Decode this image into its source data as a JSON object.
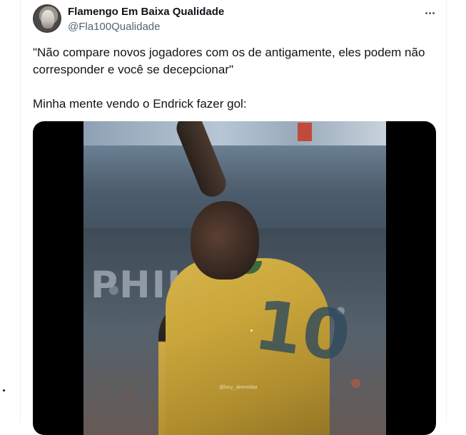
{
  "tweet": {
    "author": {
      "display_name": "Flamengo Em Baixa Qualidade",
      "handle": "@Fla100Qualidade"
    },
    "text": {
      "paragraph_1": "\"Não compare novos jogadores com os de antigamente, eles podem não corresponder e você se decepcionar\"",
      "paragraph_2": "Minha mente vendo o Endrick fazer gol:"
    },
    "media": {
      "jersey_number": "10",
      "stadium_sign": "PHILI",
      "watermark": "@lucy_ainevidaa"
    }
  },
  "icons": {
    "more": "more-horizontal-icon"
  },
  "colors": {
    "text_primary": "#0f1419",
    "text_secondary": "#536471",
    "border": "#eff3f4",
    "jersey_yellow": "#d7b54a"
  }
}
